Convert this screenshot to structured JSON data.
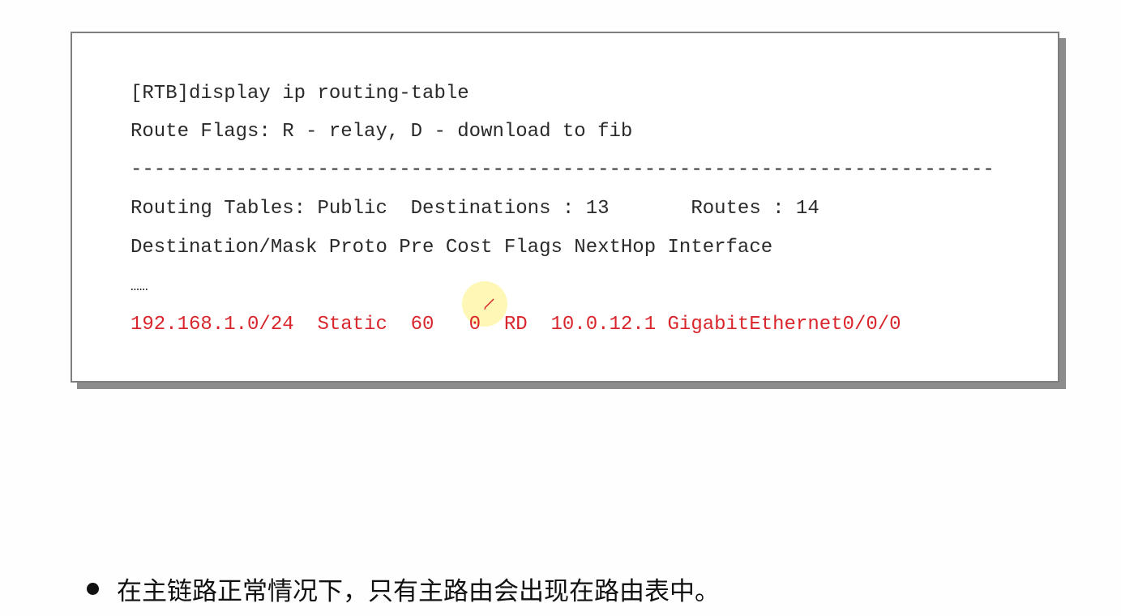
{
  "terminal": {
    "command": "[RTB]display ip routing-table",
    "flags_line": "Route Flags: R - relay, D - download to fib",
    "separator": "--------------------------------------------------------------------------",
    "tables_line": "Routing Tables: Public  Destinations : 13       Routes : 14",
    "header_line": "Destination/Mask Proto Pre Cost Flags NextHop Interface",
    "ellipsis": "……",
    "route_line": "192.168.1.0/24  Static  60   0  RD  10.0.12.1 GigabitEthernet0/0/0",
    "route_color": "#d9262c"
  },
  "bullet": {
    "text": "在主链路正常情况下，只有主路由会出现在路由表中。"
  },
  "icons": {
    "cursor": "pen-pointer-icon",
    "bullet": "bullet-dot-icon"
  }
}
